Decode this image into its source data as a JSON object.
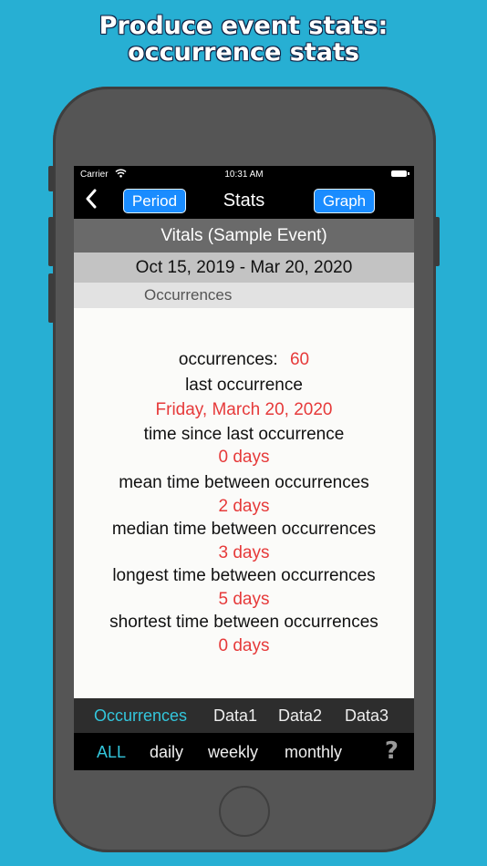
{
  "headline": {
    "line1": "Produce event stats:",
    "line2": "occurrence stats"
  },
  "status_bar": {
    "carrier": "Carrier",
    "time": "10:31 AM"
  },
  "nav": {
    "back_glyph": "‹",
    "period_label": "Period",
    "title": "Stats",
    "graph_label": "Graph"
  },
  "event_name": "Vitals (Sample Event)",
  "date_range": "Oct 15, 2019 - Mar 20, 2020",
  "section_title": "Occurrences",
  "stats": {
    "occurrences_label": "occurrences:",
    "occurrences_value": "60",
    "last_label": "last occurrence",
    "last_value": "Friday, March 20, 2020",
    "since_label": "time since last occurrence",
    "since_value": "0 days",
    "mean_label": "mean time between occurrences",
    "mean_value": "2 days",
    "median_label": "median time between occurrences",
    "median_value": "3 days",
    "longest_label": "longest time between occurrences",
    "longest_value": "5 days",
    "shortest_label": "shortest time between occurrences",
    "shortest_value": "0 days"
  },
  "tabs": [
    "Occurrences",
    "Data1",
    "Data2",
    "Data3"
  ],
  "periods": [
    "ALL",
    "daily",
    "weekly",
    "monthly"
  ],
  "help_label": "?",
  "colors": {
    "background": "#27afd3",
    "accent_cyan": "#33c6dc",
    "value_red": "#e63a3a",
    "button_blue": "#1a8cff"
  },
  "icons": {
    "wifi": "wifi-icon",
    "battery": "battery-icon",
    "back": "chevron-left-icon",
    "help": "question-mark-icon"
  }
}
